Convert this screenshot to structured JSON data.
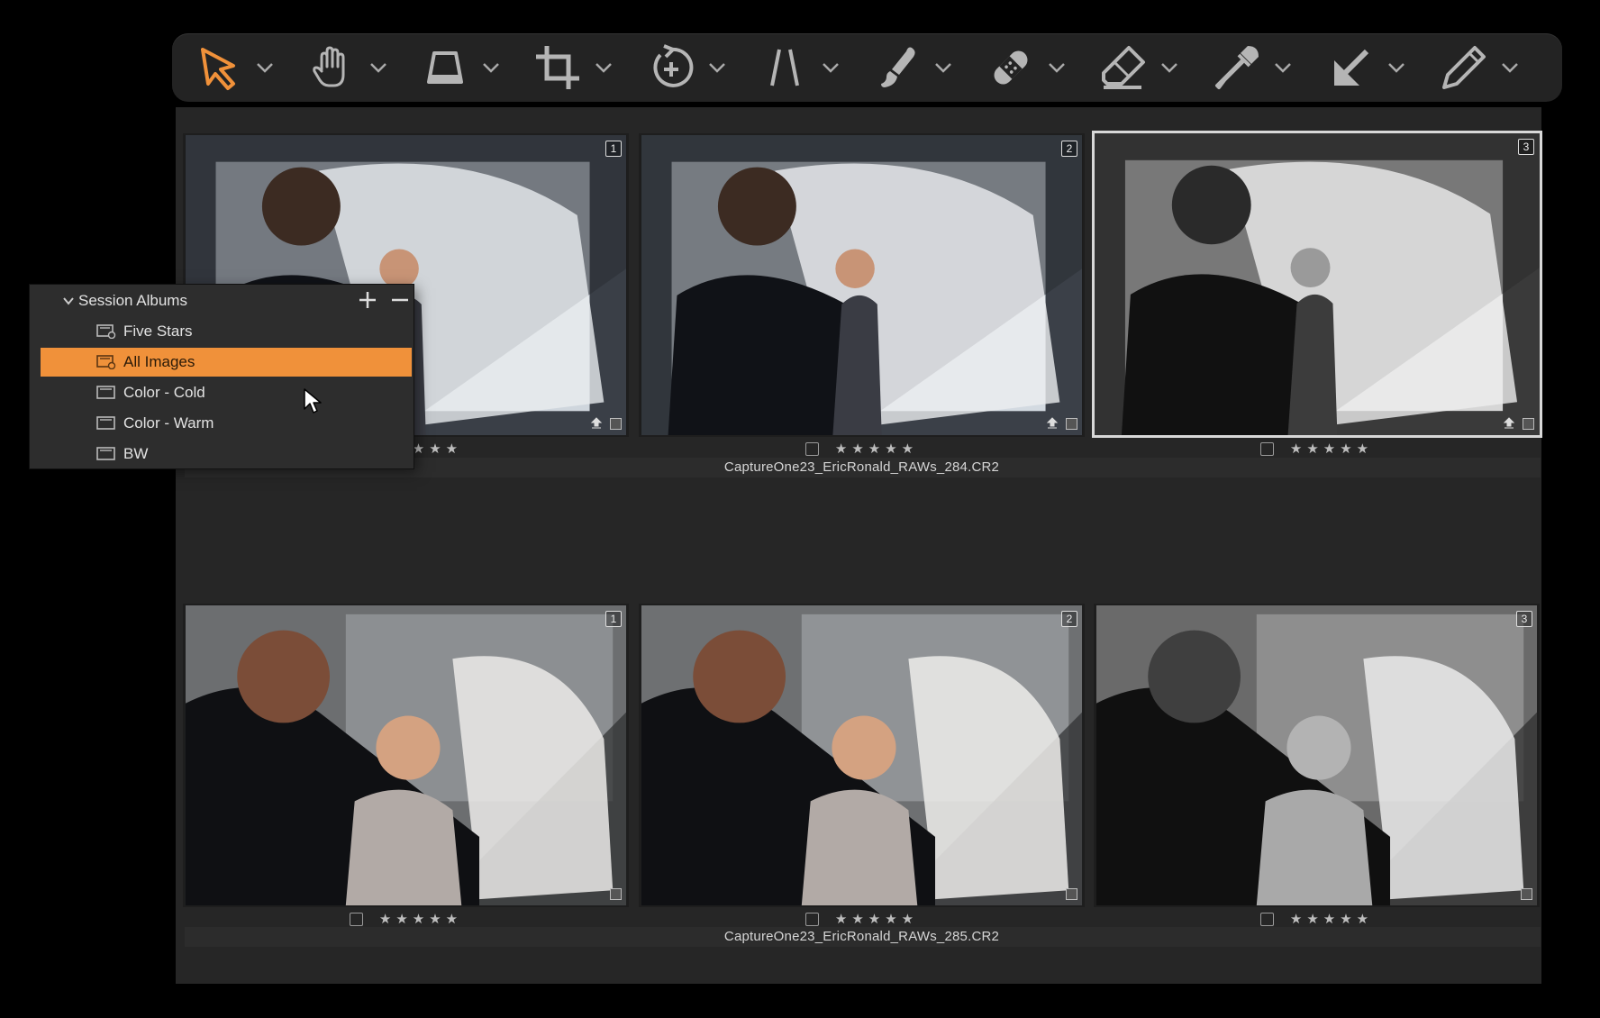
{
  "toolbar": {
    "tools": [
      {
        "name": "select-tool",
        "icon": "arrow-pointer-icon",
        "active": true
      },
      {
        "name": "pan-tool",
        "icon": "hand-icon"
      },
      {
        "name": "keystone-tool",
        "icon": "keystone-icon"
      },
      {
        "name": "crop-tool",
        "icon": "crop-icon"
      },
      {
        "name": "rotate-tool",
        "icon": "rotate-icon"
      },
      {
        "name": "lens-tool",
        "icon": "lines-icon"
      },
      {
        "name": "brush-tool",
        "icon": "brush-icon"
      },
      {
        "name": "heal-tool",
        "icon": "bandage-icon"
      },
      {
        "name": "erase-tool",
        "icon": "eraser-icon"
      },
      {
        "name": "picker-tool",
        "icon": "eyedropper-icon"
      },
      {
        "name": "annotate-tool",
        "icon": "arrow-down-left-icon"
      },
      {
        "name": "pencil-tool",
        "icon": "pencil-icon"
      }
    ],
    "accent": "#f0913a"
  },
  "albums": {
    "title": "Session Albums",
    "items": [
      {
        "label": "Five Stars",
        "type": "smart"
      },
      {
        "label": "All Images",
        "type": "smart",
        "selected": true
      },
      {
        "label": "Color - Cold",
        "type": "album"
      },
      {
        "label": "Color - Warm",
        "type": "album"
      },
      {
        "label": "BW",
        "type": "album"
      }
    ]
  },
  "browser": {
    "rows": [
      {
        "filename": "CaptureOne23_EricRonald_RAWs_284.CR2",
        "variants": [
          {
            "number": "1",
            "stars": "★★★★★",
            "style": "color"
          },
          {
            "number": "2",
            "stars": "★★★★★",
            "style": "color"
          },
          {
            "number": "3",
            "stars": "★★★★★",
            "style": "bw",
            "selected": true
          }
        ]
      },
      {
        "filename": "CaptureOne23_EricRonald_RAWs_285.CR2",
        "variants": [
          {
            "number": "1",
            "stars": "★★★★★",
            "style": "color"
          },
          {
            "number": "2",
            "stars": "★★★★★",
            "style": "color"
          },
          {
            "number": "3",
            "stars": "★★★★★",
            "style": "bw"
          }
        ]
      }
    ]
  }
}
